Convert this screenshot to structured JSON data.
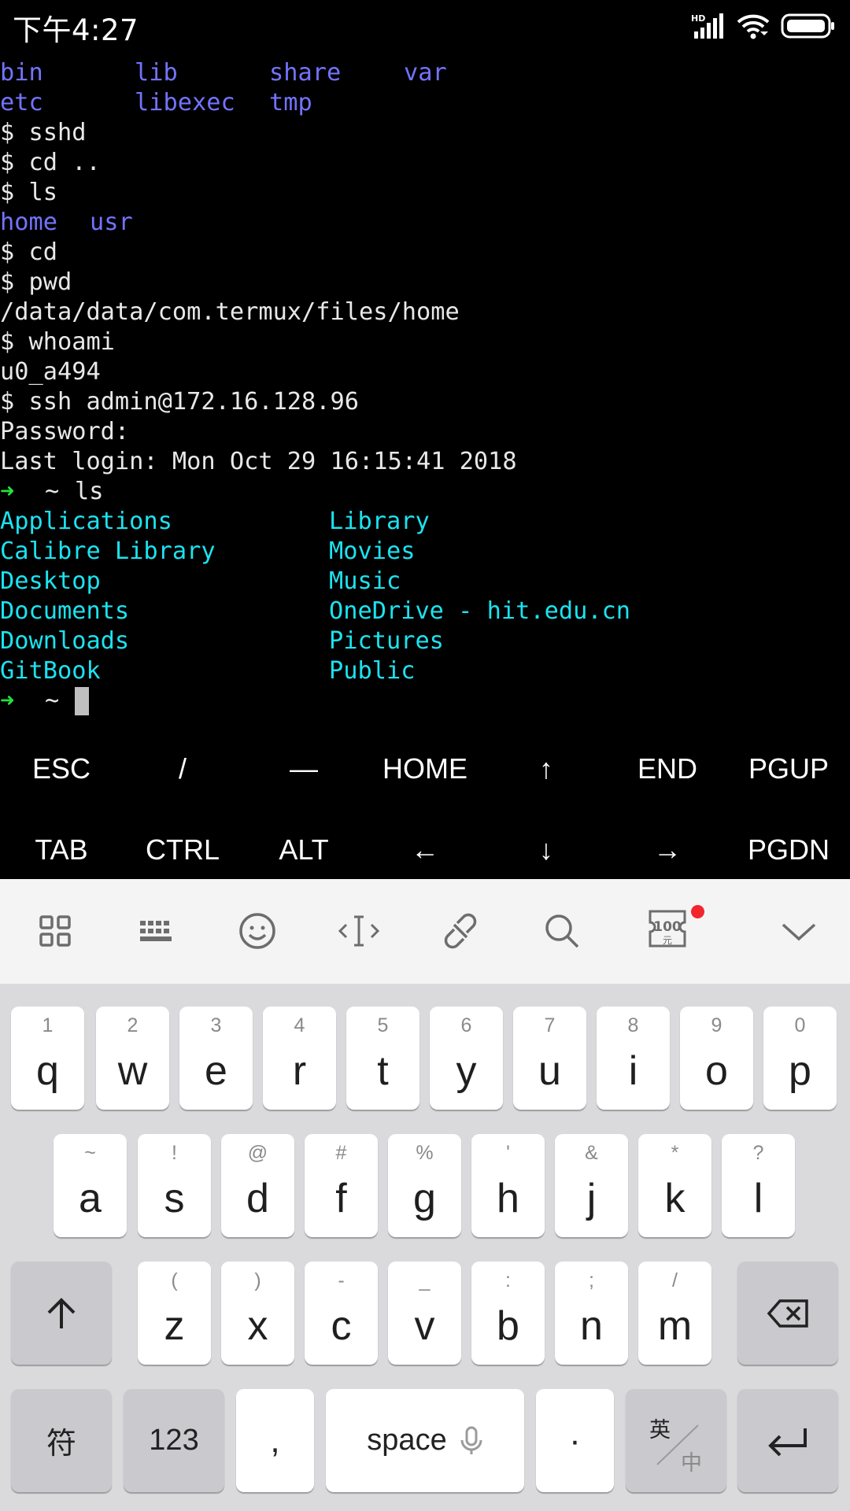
{
  "status_bar": {
    "time": "下午4:27",
    "icons": [
      "hd-signal-icon",
      "wifi-icon",
      "battery-icon"
    ]
  },
  "terminal": {
    "ls_usr": [
      [
        "bin",
        "lib",
        "share",
        "var"
      ],
      [
        "etc",
        "libexec",
        "tmp"
      ]
    ],
    "cmd_sshd": "$ sshd",
    "cmd_cd_up": "$ cd ..",
    "cmd_ls": "$ ls",
    "ls_root": [
      "home",
      "usr"
    ],
    "cmd_cd": "$ cd",
    "cmd_pwd": "$ pwd",
    "pwd_output": "/data/data/com.termux/files/home",
    "cmd_whoami": "$ whoami",
    "whoami_output": "u0_a494",
    "cmd_ssh": "$ ssh admin@172.16.128.96",
    "password_prompt": "Password:",
    "last_login": "Last login: Mon Oct 29 16:15:41 2018",
    "prompt_arrow": "➜",
    "prompt_dir": "~",
    "remote_cmd": "ls",
    "remote_ls_left": [
      "Applications",
      "Calibre Library",
      "Desktop",
      "Documents",
      "Downloads",
      "GitBook"
    ],
    "remote_ls_right": [
      "Library",
      "Movies",
      "Music",
      "OneDrive - hit.edu.cn",
      "Pictures",
      "Public"
    ],
    "colors": {
      "directory_blue": "#7373ff",
      "directory_cyan": "#1be3f0",
      "prompt_green": "#23e23a"
    }
  },
  "extra_keys": {
    "row1": [
      "ESC",
      "/",
      "—",
      "HOME",
      "↑",
      "END",
      "PGUP"
    ],
    "row2": [
      "TAB",
      "CTRL",
      "ALT",
      "←",
      "↓",
      "→",
      "PGDN"
    ]
  },
  "keyboard": {
    "toolbar_icons": [
      "grid-icon",
      "keyboard-icon",
      "emoji-icon",
      "cursor-icon",
      "clipboard-link-icon",
      "search-icon",
      "coupon-100-icon",
      "chevron-down-icon"
    ],
    "coupon_text": "100",
    "coupon_subtext": "元",
    "row1": [
      {
        "hint": "1",
        "key": "q"
      },
      {
        "hint": "2",
        "key": "w"
      },
      {
        "hint": "3",
        "key": "e"
      },
      {
        "hint": "4",
        "key": "r"
      },
      {
        "hint": "5",
        "key": "t"
      },
      {
        "hint": "6",
        "key": "y"
      },
      {
        "hint": "7",
        "key": "u"
      },
      {
        "hint": "8",
        "key": "i"
      },
      {
        "hint": "9",
        "key": "o"
      },
      {
        "hint": "0",
        "key": "p"
      }
    ],
    "row2": [
      {
        "hint": "~",
        "key": "a"
      },
      {
        "hint": "!",
        "key": "s"
      },
      {
        "hint": "@",
        "key": "d"
      },
      {
        "hint": "#",
        "key": "f"
      },
      {
        "hint": "%",
        "key": "g"
      },
      {
        "hint": "'",
        "key": "h"
      },
      {
        "hint": "&",
        "key": "j"
      },
      {
        "hint": "*",
        "key": "k"
      },
      {
        "hint": "?",
        "key": "l"
      }
    ],
    "row3": [
      {
        "hint": "(",
        "key": "z"
      },
      {
        "hint": ")",
        "key": "x"
      },
      {
        "hint": "-",
        "key": "c"
      },
      {
        "hint": "_",
        "key": "v"
      },
      {
        "hint": ":",
        "key": "b"
      },
      {
        "hint": ";",
        "key": "n"
      },
      {
        "hint": "/",
        "key": "m"
      }
    ],
    "symbols_label": "符",
    "numbers_label": "123",
    "comma_label": ",",
    "space_label": "space",
    "period_label": "·",
    "lang_top": "英",
    "lang_bottom": "中"
  }
}
